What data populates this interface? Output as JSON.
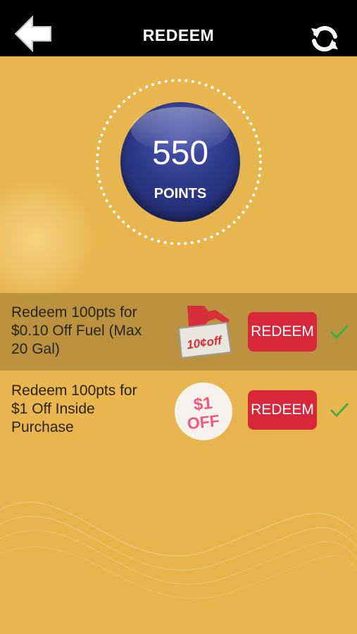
{
  "header": {
    "title": "REDEEM",
    "back_icon": "back-arrow-icon",
    "refresh_icon": "refresh-icon"
  },
  "points": {
    "value": "550",
    "label": "POINTS"
  },
  "offers": [
    {
      "text_line1": "Redeem 100pts for",
      "text_line2": "$0.10 Off Fuel (Max",
      "text_line3": "20 Gal)",
      "image_text": "10¢off",
      "button": "REDEEM",
      "selected": true
    },
    {
      "text_line1": "Redeem 100pts for",
      "text_line2": "$1 Off Inside",
      "text_line3": "Purchase",
      "image_text_line1": "$1",
      "image_text_line2": "OFF",
      "button": "REDEEM",
      "selected": false
    }
  ],
  "colors": {
    "background": "#e8b54e",
    "topbar": "#000000",
    "button": "#d9273a",
    "points_ball": "#2d3a8a",
    "check": "#3fae49"
  }
}
